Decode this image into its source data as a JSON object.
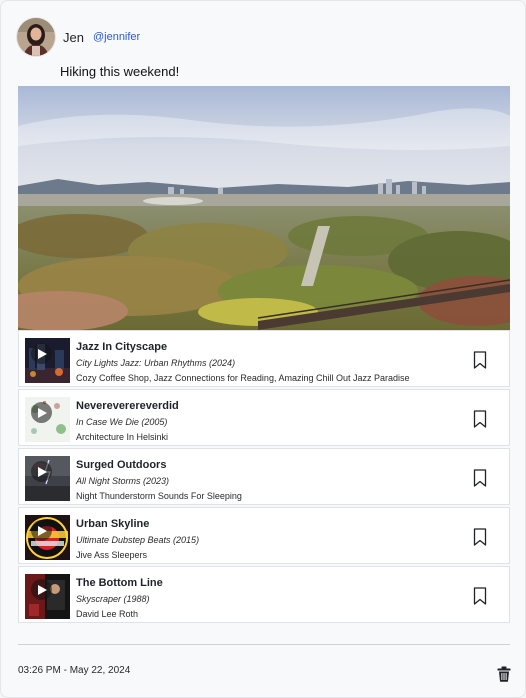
{
  "post": {
    "author_name": "Jen",
    "author_handle": "@jennifer",
    "text": "Hiking this weekend!",
    "timestamp": "03:26 PM - May 22, 2024"
  },
  "tracks": [
    {
      "title": "Jazz In Cityscape",
      "album": "City Lights Jazz: Urban Rhythms (2024)",
      "artists": "Cozy Coffee Shop, Jazz Connections for Reading, Amazing Chill Out Jazz Paradise"
    },
    {
      "title": "Nevereverereverdid",
      "album": "In Case We Die (2005)",
      "artists": "Architecture In Helsinki"
    },
    {
      "title": "Surged Outdoors",
      "album": "All Night Storms (2023)",
      "artists": "Night Thunderstorm Sounds For Sleeping"
    },
    {
      "title": "Urban Skyline",
      "album": "Ultimate Dubstep Beats (2015)",
      "artists": "Jive Ass Sleepers"
    },
    {
      "title": "The Bottom Line",
      "album": "Skyscraper (1988)",
      "artists": "David Lee Roth"
    }
  ],
  "icons": {
    "play": "play-icon",
    "bookmark": "bookmark-icon",
    "delete": "trash-icon"
  },
  "colors": {
    "handle": "#2b59d9",
    "card_background": "#f8f9fa"
  }
}
